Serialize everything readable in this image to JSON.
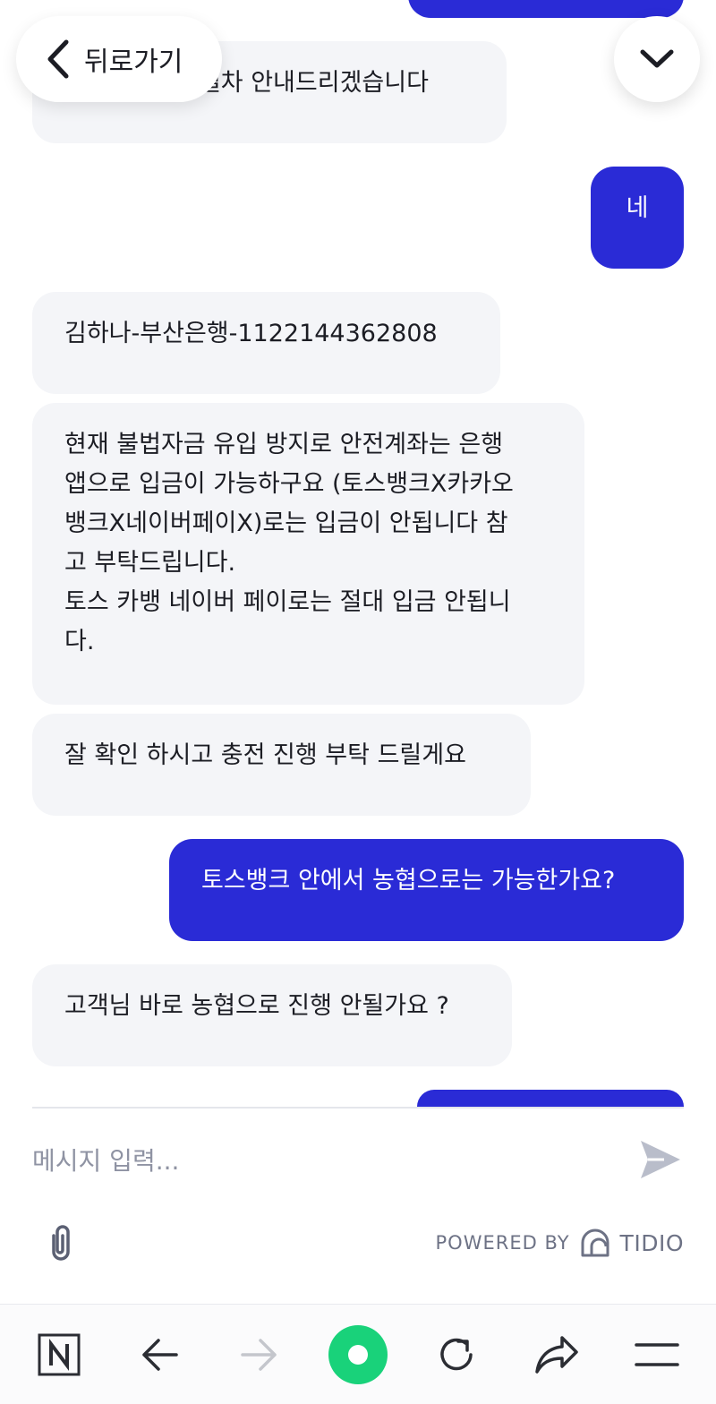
{
  "colors": {
    "accent": "#2a2bd6",
    "operator_bubble": "#f4f5f8",
    "home_green": "#19d27a"
  },
  "header": {
    "back_label": "뒤로가기",
    "back_icon": "chevron-left-icon",
    "collapse_icon": "chevron-down-icon"
  },
  "messages": {
    "m1": "결제 및 충전 절차 안내드리겠습니다",
    "m2": "네",
    "m3": "김하나-부산은행-1122144362808",
    "m4": "현재 불법자금 유입 방지로 안전계좌는 은행\n앱으로 입금이 가능하구요 (토스뱅크X카카오\n뱅크X네이버페이X)로는 입금이 안됩니다 참\n고 부탁드립니다.\n토스 카뱅 네이버 페이로는 절대 입금 안됩니\n다.",
    "m5": "잘 확인 하시고 충전 진행 부탁 드릴게요",
    "m6": "토스뱅크 안에서 농협으로는 가능한가요?",
    "m7": "고객님 바로 농협으로 진행 안될가요 ?"
  },
  "composer": {
    "placeholder": "메시지 입력...",
    "send_icon": "send-icon",
    "attach_icon": "paperclip-icon"
  },
  "footer": {
    "powered_by": "POWERED BY",
    "brand": "TIDIO"
  },
  "browser_bar": {
    "home_logo": "N",
    "icons": [
      "naver-logo-icon",
      "back-arrow-icon",
      "forward-arrow-icon",
      "home-dot-icon",
      "reload-icon",
      "share-icon",
      "menu-icon"
    ]
  }
}
